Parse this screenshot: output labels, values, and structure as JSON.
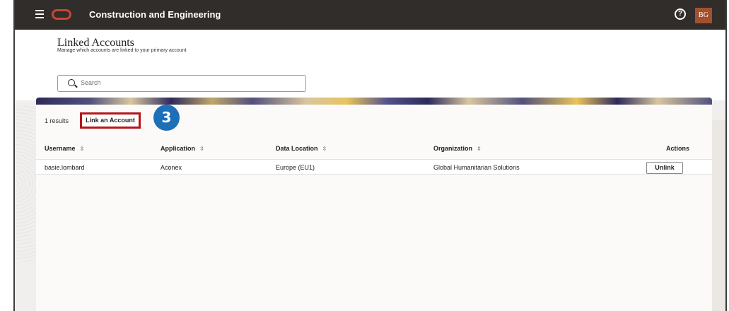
{
  "topbar": {
    "app_title": "Construction and Engineering",
    "help_icon": "help-circle-icon",
    "avatar_initials": "BG"
  },
  "page": {
    "title": "Linked Accounts",
    "subtitle": "Manage which accounts are linked to your primary account"
  },
  "search": {
    "placeholder": "Search"
  },
  "toolbar": {
    "results_count": "1 results",
    "link_account_label": "Link an Account",
    "step_number": "3"
  },
  "table": {
    "headers": {
      "username": "Username",
      "application": "Application",
      "data_location": "Data Location",
      "organization": "Organization",
      "actions": "Actions"
    },
    "sort_icon": "⇳",
    "rows": [
      {
        "username": "basie.lombard",
        "application": "Aconex",
        "data_location": "Europe (EU1)",
        "organization": "Global Humanitarian Solutions",
        "action_label": "Unlink"
      }
    ]
  },
  "colors": {
    "topbar": "#312d2a",
    "brand_red": "#c74634",
    "highlight_red": "#b5151b",
    "step_blue": "#1d6fb8",
    "avatar": "#a3502e"
  }
}
